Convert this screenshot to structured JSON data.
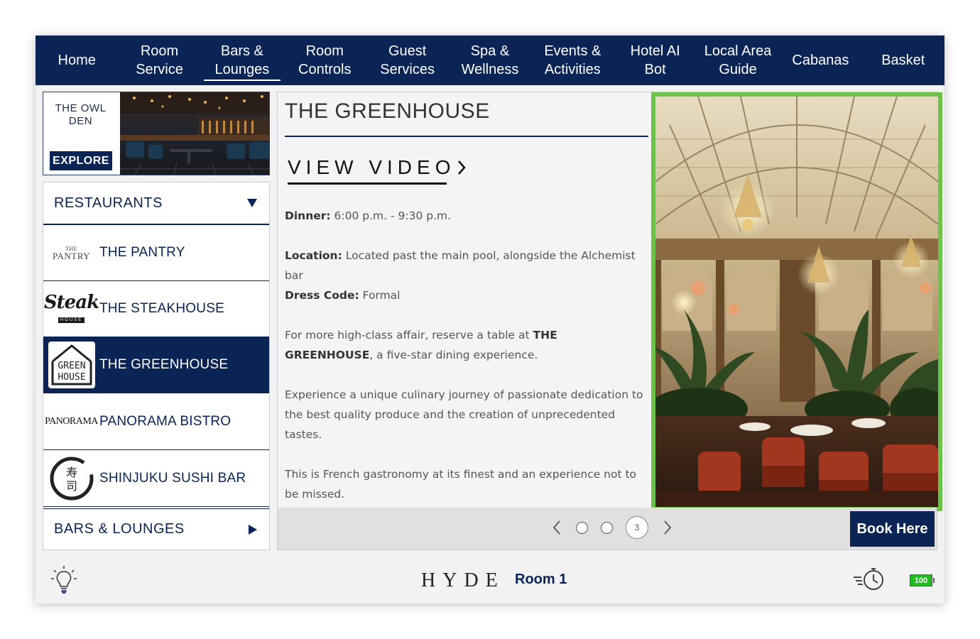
{
  "nav": {
    "items": [
      {
        "label": "Home",
        "active": false
      },
      {
        "label": "Room\nService",
        "active": false
      },
      {
        "label": "Bars &\nLounges",
        "active": true
      },
      {
        "label": "Room\nControls",
        "active": false
      },
      {
        "label": "Guest\nServices",
        "active": false
      },
      {
        "label": "Spa &\nWellness",
        "active": false
      },
      {
        "label": "Events &\nActivities",
        "active": false
      },
      {
        "label": "Hotel AI\nBot",
        "active": false
      },
      {
        "label": "Local Area\nGuide",
        "active": false
      },
      {
        "label": "Cabanas",
        "active": false
      },
      {
        "label": "Basket",
        "active": false
      }
    ]
  },
  "feature": {
    "name": "THE OWL\nDEN",
    "explore_label": "EXPLORE"
  },
  "sidebar": {
    "restaurants_label": "RESTAURANTS",
    "bars_label": "BARS & LOUNGES",
    "items": [
      {
        "label": "THE PANTRY",
        "logo_text": "THE\nPANTRY",
        "active": false
      },
      {
        "label": "THE STEAKHOUSE",
        "logo_text": "Steak",
        "logo_sub": "HOUSE",
        "active": false
      },
      {
        "label": "THE GREENHOUSE",
        "logo_text": "GREEN\nHOUSE",
        "active": true
      },
      {
        "label": "PANORAMA BISTRO",
        "logo_text": "PANORAMA",
        "active": false
      },
      {
        "label": "SHINJUKU SUSHI BAR",
        "logo_text": "寿司",
        "active": false
      }
    ]
  },
  "content": {
    "title": "THE GREENHOUSE",
    "view_video_label": "VIEW VIDEO",
    "dinner_label": "Dinner:",
    "dinner_value": "6:00 p.m. - 9:30 p.m.",
    "location_label": "Location:",
    "location_value": "Located past the main pool, alongside the Alchemist bar",
    "dress_label": "Dress Code:",
    "dress_value": "Formal",
    "para1_pre": "For more high-class affair, reserve a table at ",
    "para1_bold": "THE GREENHOUSE",
    "para1_post": ", a five-star dining experience.",
    "para2": "Experience a unique culinary journey of passionate dedication to the best quality produce and the creation of unprecedented tastes.",
    "para3": "This is French gastronomy at its finest and an experience not to be missed."
  },
  "carousel": {
    "current_page": "3",
    "book_label": "Book Here"
  },
  "footer": {
    "brand": "HYDE",
    "room_label": "Room 1",
    "battery_level": "100"
  },
  "colors": {
    "navy": "#0a2456",
    "image_border": "#6cc24a",
    "battery": "#22bb22"
  },
  "icons": [
    "lightbulb-icon",
    "clock-speed-icon",
    "battery-icon",
    "chevron-left-icon",
    "chevron-right-icon",
    "caret-down-icon",
    "caret-right-icon"
  ]
}
